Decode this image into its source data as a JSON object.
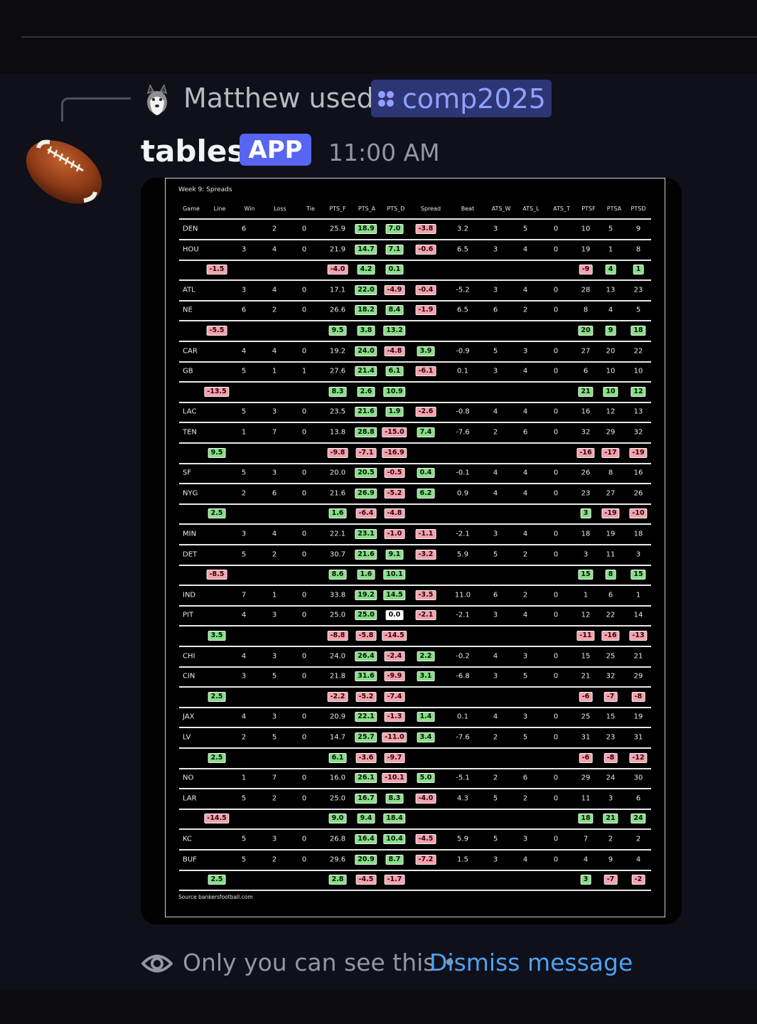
{
  "reply": {
    "user_text": "Matthew used",
    "command": "comp2025"
  },
  "message": {
    "username": "tables",
    "app_badge": "APP",
    "timestamp": "11:00 AM"
  },
  "embed": {
    "title": "Week 9: Spreads",
    "source": "Source bankersfootball.com",
    "columns": [
      "Game",
      "Line",
      "Win",
      "Loss",
      "Tie",
      "PTS_F",
      "PTS_A",
      "PTS_D",
      "Spread",
      "Beat",
      "ATS_W",
      "ATS_L",
      "ATS_T",
      "PTSF",
      "PTSA",
      "PTSD"
    ],
    "games": [
      {
        "teams": [
          [
            "DEN",
            "6",
            "2",
            "0",
            "25.9",
            "18.9",
            "7.0",
            "-3.8",
            "3.2",
            "3",
            "5",
            "0",
            "10",
            "5",
            "9"
          ],
          [
            "HOU",
            "3",
            "4",
            "0",
            "21.9",
            "14.7",
            "7.1",
            "-0.6",
            "6.5",
            "3",
            "4",
            "0",
            "19",
            "1",
            "8"
          ]
        ],
        "summary": {
          "line": "-1.5",
          "pts_f": "-4.0",
          "pts_a": "4.2",
          "pts_d": "0.1",
          "ptsf": "-9",
          "ptsa": "4",
          "ptsd": "1"
        }
      },
      {
        "teams": [
          [
            "ATL",
            "3",
            "4",
            "0",
            "17.1",
            "22.0",
            "-4.9",
            "-0.4",
            "-5.2",
            "3",
            "4",
            "0",
            "28",
            "13",
            "23"
          ],
          [
            "NE",
            "6",
            "2",
            "0",
            "26.6",
            "18.2",
            "8.4",
            "-1.9",
            "6.5",
            "6",
            "2",
            "0",
            "8",
            "4",
            "5"
          ]
        ],
        "summary": {
          "line": "-5.5",
          "pts_f": "9.5",
          "pts_a": "3.8",
          "pts_d": "13.2",
          "ptsf": "20",
          "ptsa": "9",
          "ptsd": "18"
        }
      },
      {
        "teams": [
          [
            "CAR",
            "4",
            "4",
            "0",
            "19.2",
            "24.0",
            "-4.8",
            "3.9",
            "-0.9",
            "5",
            "3",
            "0",
            "27",
            "20",
            "22"
          ],
          [
            "GB",
            "5",
            "1",
            "1",
            "27.6",
            "21.4",
            "6.1",
            "-6.1",
            "0.1",
            "3",
            "4",
            "0",
            "6",
            "10",
            "10"
          ]
        ],
        "summary": {
          "line": "-13.5",
          "pts_f": "8.3",
          "pts_a": "2.6",
          "pts_d": "10.9",
          "ptsf": "21",
          "ptsa": "10",
          "ptsd": "12"
        }
      },
      {
        "teams": [
          [
            "LAC",
            "5",
            "3",
            "0",
            "23.5",
            "21.6",
            "1.9",
            "-2.6",
            "-0.8",
            "4",
            "4",
            "0",
            "16",
            "12",
            "13"
          ],
          [
            "TEN",
            "1",
            "7",
            "0",
            "13.8",
            "28.8",
            "-15.0",
            "7.4",
            "-7.6",
            "2",
            "6",
            "0",
            "32",
            "29",
            "32"
          ]
        ],
        "summary": {
          "line": "9.5",
          "pts_f": "-9.8",
          "pts_a": "-7.1",
          "pts_d": "-16.9",
          "ptsf": "-16",
          "ptsa": "-17",
          "ptsd": "-19"
        }
      },
      {
        "teams": [
          [
            "SF",
            "5",
            "3",
            "0",
            "20.0",
            "20.5",
            "-0.5",
            "0.4",
            "-0.1",
            "4",
            "4",
            "0",
            "26",
            "8",
            "16"
          ],
          [
            "NYG",
            "2",
            "6",
            "0",
            "21.6",
            "26.9",
            "-5.2",
            "6.2",
            "0.9",
            "4",
            "4",
            "0",
            "23",
            "27",
            "26"
          ]
        ],
        "summary": {
          "line": "2.5",
          "pts_f": "1.6",
          "pts_a": "-6.4",
          "pts_d": "-4.8",
          "ptsf": "3",
          "ptsa": "-19",
          "ptsd": "-10"
        }
      },
      {
        "teams": [
          [
            "MIN",
            "3",
            "4",
            "0",
            "22.1",
            "23.1",
            "-1.0",
            "-1.1",
            "-2.1",
            "3",
            "4",
            "0",
            "18",
            "19",
            "18"
          ],
          [
            "DET",
            "5",
            "2",
            "0",
            "30.7",
            "21.6",
            "9.1",
            "-3.2",
            "5.9",
            "5",
            "2",
            "0",
            "3",
            "11",
            "3"
          ]
        ],
        "summary": {
          "line": "-8.5",
          "pts_f": "8.6",
          "pts_a": "1.6",
          "pts_d": "10.1",
          "ptsf": "15",
          "ptsa": "8",
          "ptsd": "15"
        }
      },
      {
        "teams": [
          [
            "IND",
            "7",
            "1",
            "0",
            "33.8",
            "19.2",
            "14.5",
            "-3.5",
            "11.0",
            "6",
            "2",
            "0",
            "1",
            "6",
            "1"
          ],
          [
            "PIT",
            "4",
            "3",
            "0",
            "25.0",
            "25.0",
            "0.0",
            "-2.1",
            "-2.1",
            "3",
            "4",
            "0",
            "12",
            "22",
            "14"
          ]
        ],
        "summary": {
          "line": "3.5",
          "pts_f": "-8.8",
          "pts_a": "-5.8",
          "pts_d": "-14.5",
          "ptsf": "-11",
          "ptsa": "-16",
          "ptsd": "-13"
        }
      },
      {
        "teams": [
          [
            "CHI",
            "4",
            "3",
            "0",
            "24.0",
            "26.4",
            "-2.4",
            "2.2",
            "-0.2",
            "4",
            "3",
            "0",
            "15",
            "25",
            "21"
          ],
          [
            "CIN",
            "3",
            "5",
            "0",
            "21.8",
            "31.6",
            "-9.9",
            "3.1",
            "-6.8",
            "3",
            "5",
            "0",
            "21",
            "32",
            "29"
          ]
        ],
        "summary": {
          "line": "2.5",
          "pts_f": "-2.2",
          "pts_a": "-5.2",
          "pts_d": "-7.4",
          "ptsf": "-6",
          "ptsa": "-7",
          "ptsd": "-8"
        }
      },
      {
        "teams": [
          [
            "JAX",
            "4",
            "3",
            "0",
            "20.9",
            "22.1",
            "-1.3",
            "1.4",
            "0.1",
            "4",
            "3",
            "0",
            "25",
            "15",
            "19"
          ],
          [
            "LV",
            "2",
            "5",
            "0",
            "14.7",
            "25.7",
            "-11.0",
            "3.4",
            "-7.6",
            "2",
            "5",
            "0",
            "31",
            "23",
            "31"
          ]
        ],
        "summary": {
          "line": "2.5",
          "pts_f": "6.1",
          "pts_a": "-3.6",
          "pts_d": "-9.7",
          "ptsf": "-6",
          "ptsa": "-8",
          "ptsd": "-12"
        }
      },
      {
        "teams": [
          [
            "NO",
            "1",
            "7",
            "0",
            "16.0",
            "26.1",
            "-10.1",
            "5.0",
            "-5.1",
            "2",
            "6",
            "0",
            "29",
            "24",
            "30"
          ],
          [
            "LAR",
            "5",
            "2",
            "0",
            "25.0",
            "16.7",
            "8.3",
            "-4.0",
            "4.3",
            "5",
            "2",
            "0",
            "11",
            "3",
            "6"
          ]
        ],
        "summary": {
          "line": "-14.5",
          "pts_f": "9.0",
          "pts_a": "9.4",
          "pts_d": "18.4",
          "ptsf": "18",
          "ptsa": "21",
          "ptsd": "24"
        }
      },
      {
        "teams": [
          [
            "KC",
            "5",
            "3",
            "0",
            "26.8",
            "16.4",
            "10.4",
            "-4.5",
            "5.9",
            "5",
            "3",
            "0",
            "7",
            "2",
            "2"
          ],
          [
            "BUF",
            "5",
            "2",
            "0",
            "29.6",
            "20.9",
            "8.7",
            "-7.2",
            "1.5",
            "3",
            "4",
            "0",
            "4",
            "9",
            "4"
          ]
        ],
        "summary": {
          "line": "2.5",
          "pts_f": "2.8",
          "pts_a": "-4.5",
          "pts_d": "-1.7",
          "ptsf": "3",
          "ptsa": "-7",
          "ptsd": "-2"
        }
      }
    ]
  },
  "footer": {
    "notice": "Only you can see this",
    "separator": "•",
    "dismiss": "Dismiss message"
  },
  "colors": {
    "positive": "#86df86",
    "negative": "#f4a2ae",
    "blurple": "#5865f2",
    "link": "#4ea2f2"
  }
}
